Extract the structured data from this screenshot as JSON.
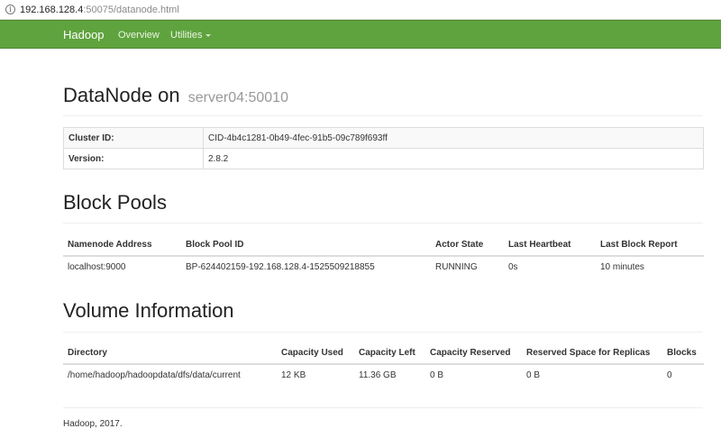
{
  "browser": {
    "url_host": "192.168.128.4",
    "url_path": ":50075/datanode.html"
  },
  "navbar": {
    "brand": "Hadoop",
    "overview": "Overview",
    "utilities": "Utilities"
  },
  "header": {
    "title": "DataNode on",
    "subtitle": "server04:50010"
  },
  "info": {
    "cluster_id_label": "Cluster ID:",
    "cluster_id_value": "CID-4b4c1281-0b49-4fec-91b5-09c789f693ff",
    "version_label": "Version:",
    "version_value": "2.8.2"
  },
  "block_pools": {
    "title": "Block Pools",
    "columns": [
      "Namenode Address",
      "Block Pool ID",
      "Actor State",
      "Last Heartbeat",
      "Last Block Report"
    ],
    "rows": [
      [
        "localhost:9000",
        "BP-624402159-192.168.128.4-1525509218855",
        "RUNNING",
        "0s",
        "10 minutes"
      ]
    ]
  },
  "volumes": {
    "title": "Volume Information",
    "columns": [
      "Directory",
      "Capacity Used",
      "Capacity Left",
      "Capacity Reserved",
      "Reserved Space for Replicas",
      "Blocks"
    ],
    "rows": [
      [
        "/home/hadoop/hadoopdata/dfs/data/current",
        "12 KB",
        "11.36 GB",
        "0 B",
        "0 B",
        "0"
      ]
    ]
  },
  "footer": {
    "text": "Hadoop, 2017."
  },
  "colors": {
    "navbar": "#5fa33e",
    "text": "#333333",
    "subtitle": "#999999"
  }
}
